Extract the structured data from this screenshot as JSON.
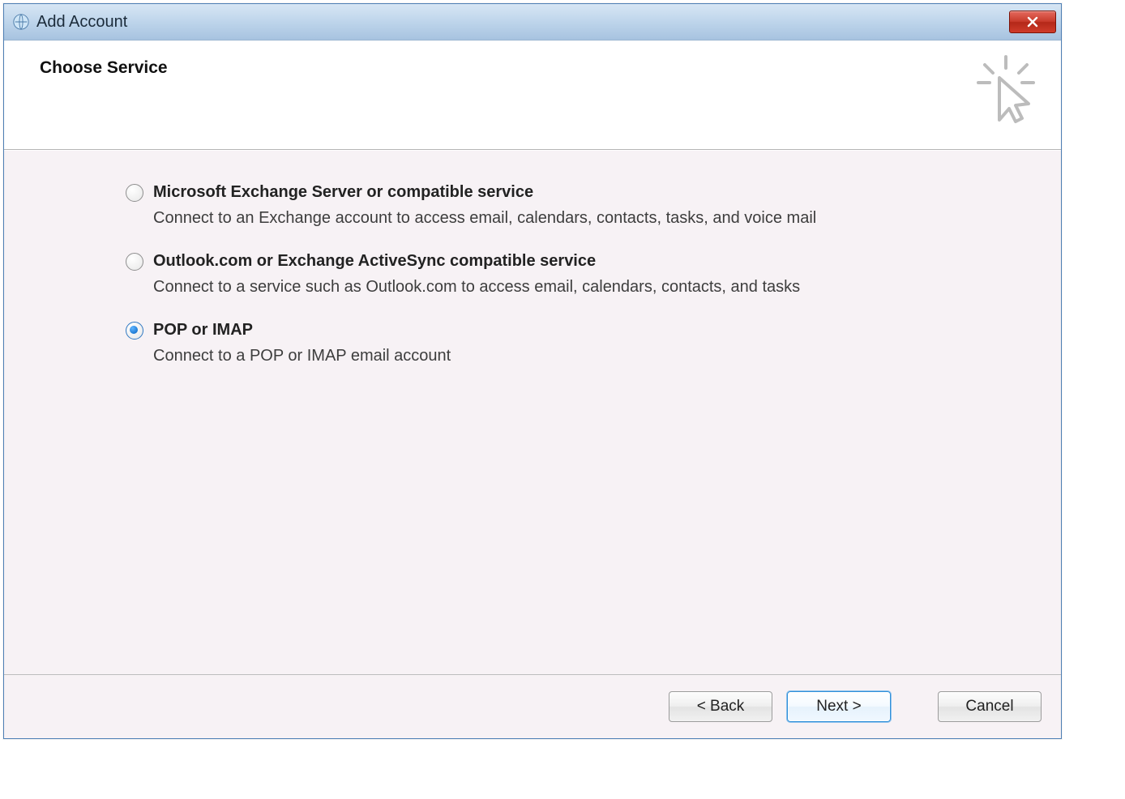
{
  "window": {
    "title": "Add Account"
  },
  "header": {
    "heading": "Choose Service"
  },
  "options": {
    "exchange": {
      "title": "Microsoft Exchange Server or compatible service",
      "desc": "Connect to an Exchange account to access email, calendars, contacts, tasks, and voice mail",
      "selected": false
    },
    "activesync": {
      "title": "Outlook.com or Exchange ActiveSync compatible service",
      "desc": "Connect to a service such as Outlook.com to access email, calendars, contacts, and tasks",
      "selected": false
    },
    "pop_imap": {
      "title": "POP or IMAP",
      "desc": "Connect to a POP or IMAP email account",
      "selected": true
    }
  },
  "footer": {
    "back": "< Back",
    "next": "Next >",
    "cancel": "Cancel"
  }
}
